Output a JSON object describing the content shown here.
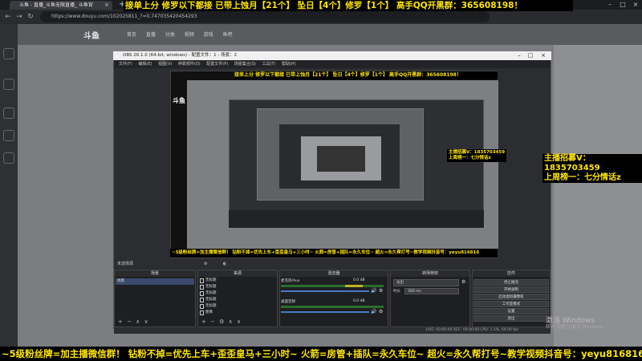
{
  "browser": {
    "tab_title": "斗鱼 - 直播_斗鱼无限直播_ 斗鱼官",
    "url": "https://www.douyu.com/102025811_?=0.747035420454293"
  },
  "banners": {
    "top": "接单上分 修罗以下都接 已带上蚀月【21个】 坠日【4个】修罗【1个】 高手QQ开黑群：365608198！",
    "bottom": "~5级粉丝牌=加主播微信群！ 钻粉不掉=优先上车+歪歪皇马+三小时~ 火箭=房管+插队=永久车位~ 超火=永久帮打号~教学视频抖音号：yeyu816816",
    "preview_footer": "~5级粉丝牌=加主播微信群！ 钻粉不掉=优先上车+歪歪皇马+三小时~ 火箭=房管+插队=永久车位~ 超火=永久帮打号~教学视频抖音号：yeyu816816",
    "right_line1": "主播招募V：1835703459",
    "right_line2": "上周榜一：七分情话z",
    "mid_line1": "主播招募V：1835703459",
    "mid_line2": "上周榜一：七分情话z"
  },
  "obs": {
    "window_title": "OBS 26.1.0 (64-bit, windows) - 配置文件：1 - 场景：2",
    "menu": "文件(F) 编辑(E) 视图(V) 停靠部件(D) 配置文件(P) 场景集合(S) 工具(T) 帮助(H)",
    "scene_label": "未选择源",
    "docks": {
      "scenes": "场景",
      "sources": "来源",
      "mixer": "混音器",
      "transitions": "转场特效",
      "controls": "控件"
    },
    "scene_item": "场景",
    "sources": [
      "无标题",
      "无标题",
      "无标题",
      "无标题",
      "无标题",
      "图像"
    ],
    "mixer": [
      {
        "label": "麦克风/Aux",
        "value": "0.0 dB"
      },
      {
        "label": "桌面音频",
        "value": "0.0 dB"
      }
    ],
    "transition": {
      "type": "淡出",
      "duration_label": "时长",
      "duration": "300 ms"
    },
    "controls": [
      "停止推流",
      "开始录制",
      "启动虚拟摄像机",
      "工作室模式",
      "设置",
      "退出"
    ],
    "status": "LIVE: 00:00:00   REC: 00:00:00   CPU: 1.1%, 60.00 fps"
  },
  "watermark": {
    "line1": "激活 Windows",
    "line2": "转到\"设置\"以激活 Windows。"
  },
  "douyu": {
    "logo": "斗鱼",
    "nav": "首页 直播 分类 视频 游戏 鱼吧"
  }
}
